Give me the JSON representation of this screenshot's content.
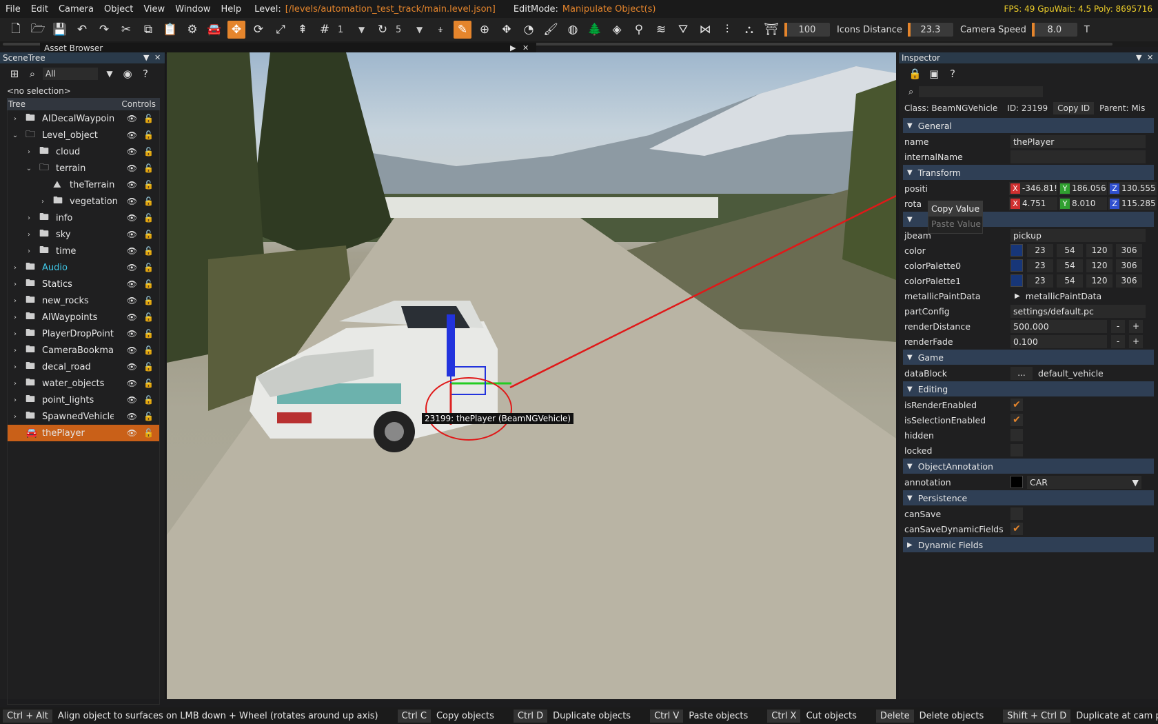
{
  "menubar": {
    "items": [
      "File",
      "Edit",
      "Camera",
      "Object",
      "View",
      "Window",
      "Help"
    ],
    "level_label": "Level:",
    "level_path": "[/levels/automation_test_track/main.level.json]",
    "editmode_label": "EditMode:",
    "editmode_value": "Manipulate Object(s)",
    "stats": "FPS: 49  GpuWait: 4.5  Poly: 8695716"
  },
  "toolbar": {
    "snap_value": "1",
    "rotate_snap_value": "5",
    "slider1_value": "100",
    "icons_distance_label": "Icons Distance",
    "icons_distance_value": "23.3",
    "camera_speed_label": "Camera Speed",
    "camera_speed_value": "8.0",
    "trailing_label": "T"
  },
  "asset_browser": {
    "title": "Asset Browser"
  },
  "scenetree": {
    "title": "SceneTree",
    "filter_value": "All",
    "selection": "<no selection>",
    "col_tree": "Tree",
    "col_controls": "Controls",
    "rows": [
      {
        "label": "AIDecalWaypoints",
        "indent": 0,
        "expanded": false
      },
      {
        "label": "Level_object",
        "indent": 0,
        "expanded": true
      },
      {
        "label": "cloud",
        "indent": 1,
        "expanded": false
      },
      {
        "label": "terrain",
        "indent": 1,
        "expanded": true
      },
      {
        "label": "theTerrain",
        "indent": 2,
        "expanded": null
      },
      {
        "label": "vegetation",
        "indent": 2,
        "expanded": false
      },
      {
        "label": "info",
        "indent": 1,
        "expanded": false
      },
      {
        "label": "sky",
        "indent": 1,
        "expanded": false
      },
      {
        "label": "time",
        "indent": 1,
        "expanded": false
      },
      {
        "label": "Audio",
        "indent": 0,
        "expanded": false
      },
      {
        "label": "Statics",
        "indent": 0,
        "expanded": false
      },
      {
        "label": "new_rocks",
        "indent": 0,
        "expanded": false
      },
      {
        "label": "AIWaypoints",
        "indent": 0,
        "expanded": false
      },
      {
        "label": "PlayerDropPoints",
        "indent": 0,
        "expanded": false
      },
      {
        "label": "CameraBookmarks",
        "indent": 0,
        "expanded": false
      },
      {
        "label": "decal_road",
        "indent": 0,
        "expanded": false
      },
      {
        "label": "water_objects",
        "indent": 0,
        "expanded": false
      },
      {
        "label": "point_lights",
        "indent": 0,
        "expanded": false
      },
      {
        "label": "SpawnedVehicles",
        "indent": 0,
        "expanded": false
      },
      {
        "label": "thePlayer",
        "indent": 0,
        "expanded": null
      }
    ]
  },
  "viewport": {
    "object_label": "23199: thePlayer (BeamNGVehicle)"
  },
  "inspector": {
    "title": "Inspector",
    "class_label": "Class: BeamNGVehicle",
    "id_label": "ID: 23199",
    "copy_id": "Copy ID",
    "parent_label": "Parent: Mis",
    "sections": {
      "general": "General",
      "transform": "Transform",
      "game": "Game",
      "editing": "Editing",
      "annotation": "ObjectAnnotation",
      "persistence": "Persistence",
      "dynamic": "Dynamic Fields"
    },
    "name_label": "name",
    "name_value": "thePlayer",
    "internal_label": "internalName",
    "internal_value": "",
    "position_label": "positi",
    "position": {
      "x": "-346.81!",
      "y": "186.056",
      "z": "130.555"
    },
    "rotation_label": "rota",
    "rotation": {
      "x": "4.751",
      "y": "8.010",
      "z": "115.285"
    },
    "jbeam_label": "jbeam",
    "jbeam_value": "pickup",
    "color_label": "color",
    "color": [
      "23",
      "54",
      "120",
      "306"
    ],
    "cp0_label": "colorPalette0",
    "cp0": [
      "23",
      "54",
      "120",
      "306"
    ],
    "cp1_label": "colorPalette1",
    "cp1": [
      "23",
      "54",
      "120",
      "306"
    ],
    "metallic_label": "metallicPaintData",
    "metallic_value": "metallicPaintData",
    "partconfig_label": "partConfig",
    "partconfig_value": "settings/default.pc",
    "renderdist_label": "renderDistance",
    "renderdist_value": "500.000",
    "renderfade_label": "renderFade",
    "renderfade_value": "0.100",
    "datablock_label": "dataBlock",
    "datablock_btn": "...",
    "datablock_value": "default_vehicle",
    "isrender_label": "isRenderEnabled",
    "isselect_label": "isSelectionEnabled",
    "hidden_label": "hidden",
    "locked_label": "locked",
    "annotation_label": "annotation",
    "annotation_value": "CAR",
    "cansave_label": "canSave",
    "cansavedyn_label": "canSaveDynamicFields",
    "context_menu": {
      "copy": "Copy Value",
      "paste": "Paste Value"
    },
    "accent_color": "#e5852c",
    "section_color": "#2f3f55"
  },
  "statusbar": [
    {
      "key": "Ctrl + Alt",
      "desc": "Align object to surfaces on LMB down + Wheel (rotates around up axis)"
    },
    {
      "key": "Ctrl C",
      "desc": "Copy objects"
    },
    {
      "key": "Ctrl D",
      "desc": "Duplicate objects"
    },
    {
      "key": "Ctrl V",
      "desc": "Paste objects"
    },
    {
      "key": "Ctrl X",
      "desc": "Cut objects"
    },
    {
      "key": "Delete",
      "desc": "Delete objects"
    },
    {
      "key": "Shift + Ctrl D",
      "desc": "Duplicate at cam pos"
    }
  ]
}
